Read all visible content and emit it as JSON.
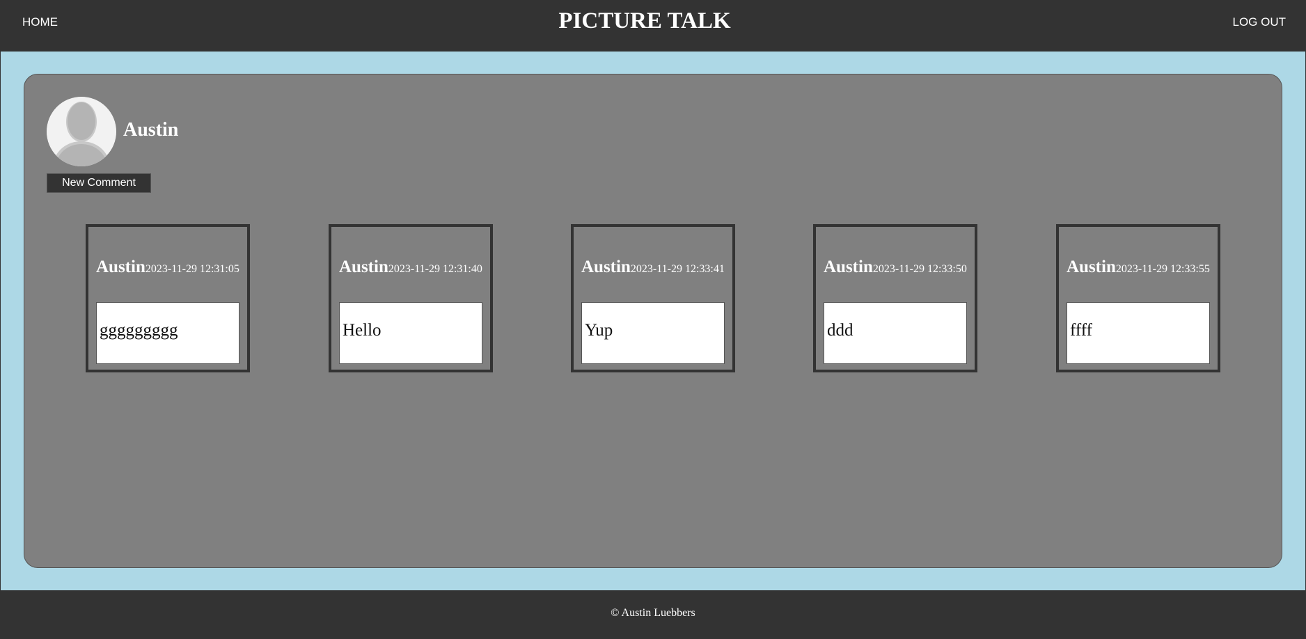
{
  "nav": {
    "home_label": "HOME",
    "title": "PICTURE TALK",
    "logout_label": "LOG OUT"
  },
  "profile": {
    "username": "Austin",
    "new_comment_label": "New Comment"
  },
  "comments": [
    {
      "author": "Austin",
      "timestamp": "2023-11-29 12:31:05",
      "text": "ggggggggg"
    },
    {
      "author": "Austin",
      "timestamp": "2023-11-29 12:31:40",
      "text": "Hello"
    },
    {
      "author": "Austin",
      "timestamp": "2023-11-29 12:33:41",
      "text": "Yup"
    },
    {
      "author": "Austin",
      "timestamp": "2023-11-29 12:33:50",
      "text": "ddd"
    },
    {
      "author": "Austin",
      "timestamp": "2023-11-29 12:33:55",
      "text": "ffff"
    }
  ],
  "footer": {
    "copyright": "© Austin Luebbers"
  },
  "colors": {
    "nav_bg": "#333333",
    "page_bg": "#add8e6",
    "panel_bg": "#808080",
    "card_border": "#333333"
  },
  "icons": {
    "avatar": "default-user-icon"
  }
}
